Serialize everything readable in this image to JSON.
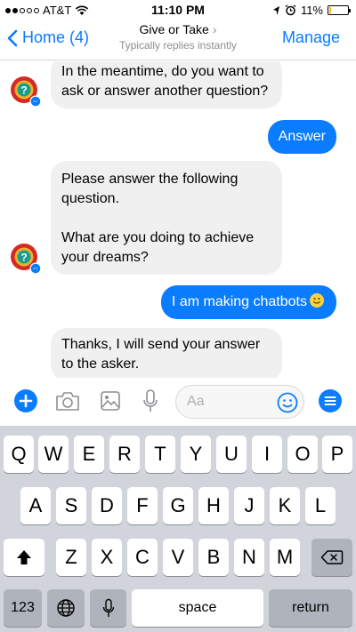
{
  "status_bar": {
    "carrier": "AT&T",
    "time": "11:10 PM",
    "battery_percent": "11%",
    "battery_level": 0.11,
    "battery_color": "#f4c01a"
  },
  "nav": {
    "back_label": "Home (4)",
    "title": "Give or Take",
    "subtitle": "Typically replies instantly",
    "manage_label": "Manage"
  },
  "messages": [
    {
      "from": "bot",
      "lines": [
        "In the meantime, do you want to",
        "ask or answer another question?"
      ]
    },
    {
      "from": "user",
      "text": "Answer"
    },
    {
      "from": "bot",
      "lines": [
        "Please answer the following",
        "question.",
        "",
        "What are you doing to achieve",
        "your dreams?"
      ]
    },
    {
      "from": "user",
      "text": "I am making chatbots",
      "emoji": "smiley-emoji"
    },
    {
      "from": "bot",
      "lines": [
        "Thanks, I will send your answer",
        "to the asker."
      ]
    }
  ],
  "composer": {
    "placeholder": "Aa",
    "icons": [
      "plus-icon",
      "camera-icon",
      "image-icon",
      "microphone-icon",
      "smiley-icon",
      "menu-icon"
    ]
  },
  "keyboard": {
    "row1": [
      "Q",
      "W",
      "E",
      "R",
      "T",
      "Y",
      "U",
      "I",
      "O",
      "P"
    ],
    "row2": [
      "A",
      "S",
      "D",
      "F",
      "G",
      "H",
      "J",
      "K",
      "L"
    ],
    "row3": [
      "Z",
      "X",
      "C",
      "V",
      "B",
      "N",
      "M"
    ],
    "numbers_label": "123",
    "space_label": "space",
    "return_label": "return"
  },
  "colors": {
    "accent": "#0a7aff",
    "outgoing_bubble": "#0a7cff",
    "incoming_bubble": "#f0f0f0",
    "keyboard_bg": "#d1d4da"
  }
}
